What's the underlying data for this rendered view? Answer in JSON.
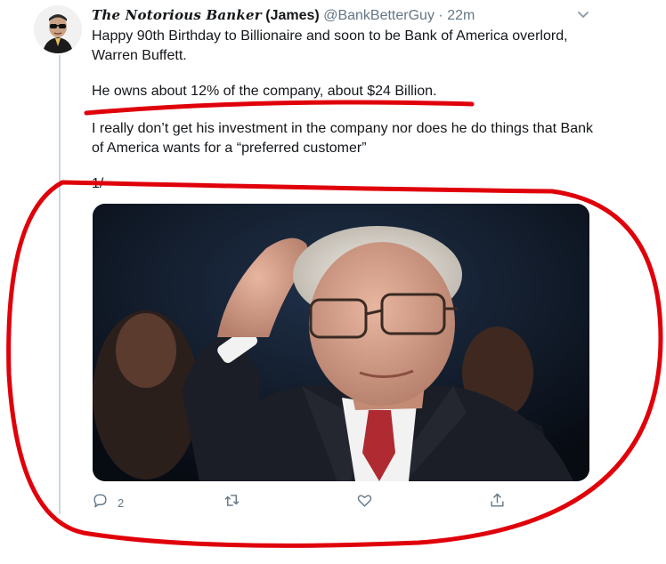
{
  "tweet": {
    "display_name_styled": "The Notorious Banker",
    "display_name_suffix": "(James)",
    "handle": "@BankBetterGuy",
    "separator": "·",
    "time": "22m",
    "paragraphs": [
      "Happy 90th Birthday to Billionaire and soon to be Bank of America overlord, Warren Buffett.",
      "He owns about 12% of the company, about $24 Billion.",
      "I really don’t get his investment in the company nor does he do things that Bank of America wants for a “preferred customer”",
      "1/"
    ]
  },
  "actions": {
    "reply_count": "2",
    "retweet_count": "",
    "like_count": ""
  },
  "icons": {
    "menu": "chevron-down-icon",
    "reply": "reply-icon",
    "retweet": "retweet-icon",
    "like": "heart-icon",
    "share": "share-icon"
  },
  "colors": {
    "annotation": "#e0000a",
    "secondary_text": "#657786",
    "thread_line": "#ccd6dd"
  }
}
